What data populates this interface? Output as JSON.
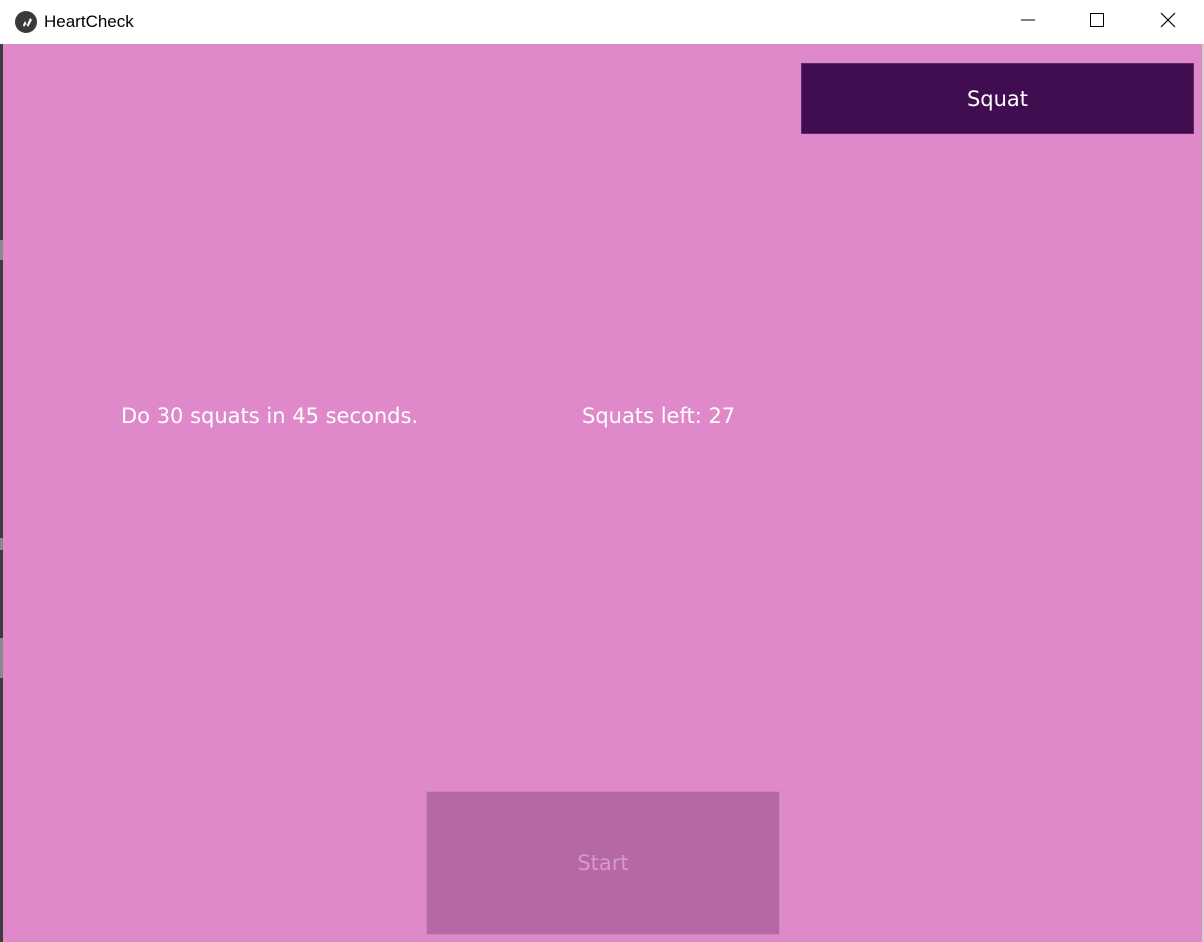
{
  "window": {
    "title": "HeartCheck",
    "icon": "kivy-logo-icon",
    "controls": {
      "minimize_icon": "minimize-icon",
      "maximize_icon": "maximize-icon",
      "close_icon": "close-icon"
    }
  },
  "main": {
    "squat_button_label": "Squat",
    "instruction_text": "Do 30 squats in 45 seconds.",
    "squats_left_text": "Squats left: 27",
    "start_button_label": "Start",
    "start_button_state": "disabled"
  },
  "colors": {
    "background": "#df89cb",
    "squat_button": "#400d50",
    "start_button_disabled": "#b667a6",
    "text": "#ffffff"
  }
}
